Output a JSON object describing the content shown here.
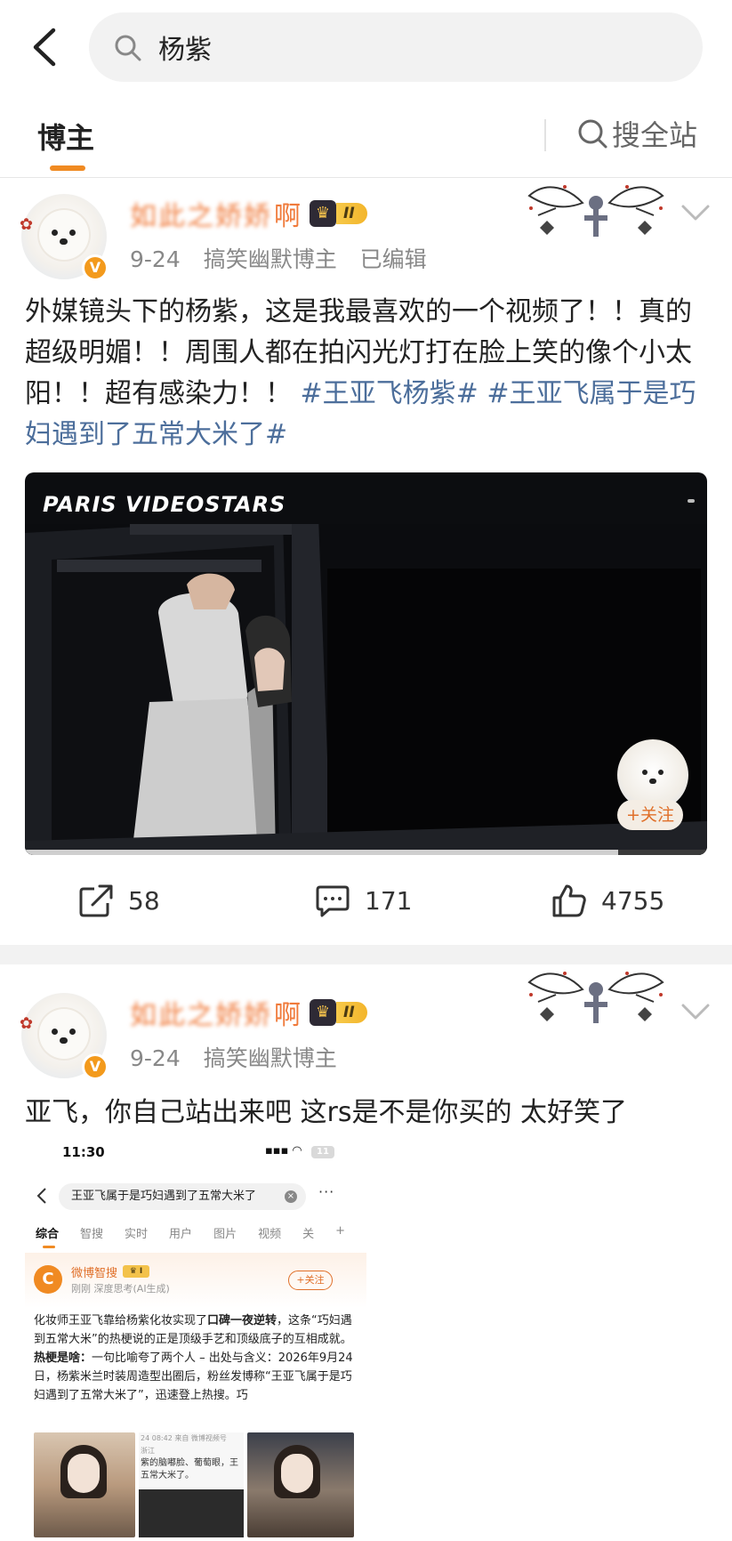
{
  "search": {
    "query": "杨紫"
  },
  "tabs": {
    "active": "博主",
    "search_all": "搜全站"
  },
  "posts": [
    {
      "author_suffix": "啊",
      "author_blurred": "如此之娇娇",
      "vip_level": "II",
      "date": "9-24",
      "category": "搞笑幽默博主",
      "edited": "已编辑",
      "text": "外媒镜头下的杨紫，这是我最喜欢的一个视频了！！真的超级明媚！！周围人都在拍闪光灯打在脸上笑的像个小太阳！！超有感染力！！",
      "hashtags": [
        "#王亚飞杨紫#",
        "#王亚飞属于是巧妇遇到了五常大米了#"
      ],
      "video_tag": "PARIS VIDEOSTARS",
      "video_follow": "+关注",
      "video_progress": 0.87,
      "reposts": "58",
      "comments": "171",
      "likes": "4755"
    },
    {
      "author_suffix": "啊",
      "author_blurred": "如此之娇娇",
      "vip_level": "II",
      "date": "9-24",
      "category": "搞笑幽默博主",
      "text": "亚飞，你自己站出来吧 这rs是不是你买的 太好笑了"
    }
  ],
  "screenshot": {
    "time": "11:30",
    "battery": "11",
    "query": "王亚飞属于是巧妇遇到了五常大米了",
    "tabs": [
      "综合",
      "智搜",
      "实时",
      "用户",
      "图片",
      "视频",
      "关"
    ],
    "plus": "+",
    "ai_name": "微博智搜",
    "ai_sub": "刚刚 深度思考(AI生成)",
    "ai_follow": "+关注",
    "body_1a": "化妆师王亚飞靠给杨紫化妆实现了",
    "body_1b": "口碑一夜逆转",
    "body_1c": "，这条“巧妇遇到五常大米”的热梗说的正是顶级手艺和顶级底子的互相成就。",
    "body_2a": "热梗是啥：",
    "body_2b": "一句比喻夸了两个人 – 出处与含义：2026年9月24日，杨紫米兰时装周造型出圈后，粉丝发博称“王亚飞属于是巧妇遇到了五常大米了”，迅速登上热搜。巧",
    "thumb_meta": "24 08:42 来自 微博视频号",
    "thumb_place": "浙江",
    "thumb_text": "紫的脑嘟脸、葡萄眼，王五常大米了。"
  }
}
